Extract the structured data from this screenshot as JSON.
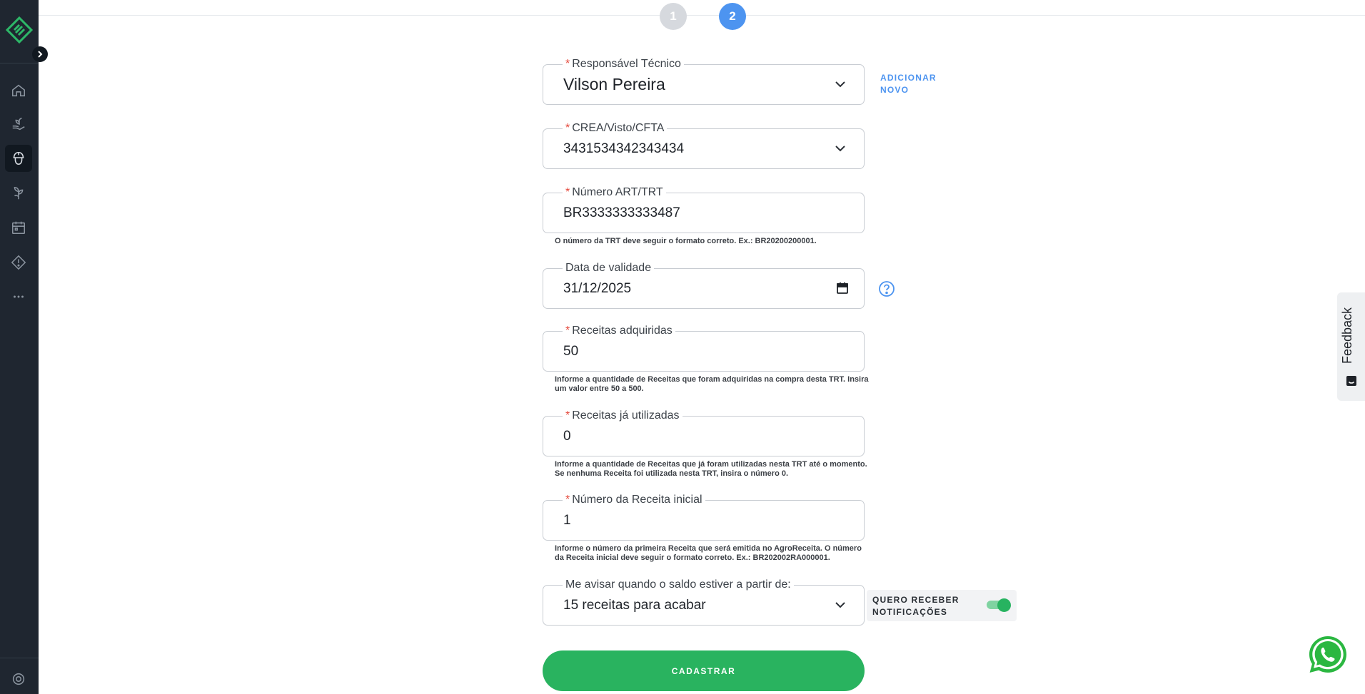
{
  "stepper": {
    "step1": "1",
    "step2": "2"
  },
  "form": {
    "responsavel": {
      "label": "Responsável Técnico",
      "value": "Vilson Pereira"
    },
    "add_new": {
      "line1": "ADICIONAR",
      "line2": "NOVO"
    },
    "crea": {
      "label": "CREA/Visto/CFTA",
      "value": "3431534342343434"
    },
    "art": {
      "label": "Número ART/TRT",
      "value": "BR3333333333487",
      "hint": "O número da TRT deve seguir o formato correto. Ex.: BR20200200001."
    },
    "validade": {
      "label": "Data de validade",
      "value": "31/12/2025"
    },
    "adquiridas": {
      "label": "Receitas adquiridas",
      "value": "50",
      "hint_line1": "Informe a quantidade de Receitas que foram adquiridas na compra desta TRT. Insira",
      "hint_line2": "um valor entre 50 a 500."
    },
    "utilizadas": {
      "label": "Receitas já utilizadas",
      "value": "0",
      "hint_line1": "Informe a quantidade de Receitas que já foram utilizadas nesta TRT até o momento.",
      "hint_line2": "Se nenhuma Receita foi utilizada nesta TRT, insira o número 0."
    },
    "inicial": {
      "label": "Número da Receita inicial",
      "value": "1",
      "hint_line1": "Informe o número da primeira Receita que será emitida no AgroReceita. O número",
      "hint_line2": "da Receita inicial deve seguir o formato correto. Ex.: BR202002RA000001."
    },
    "aviso": {
      "label": "Me avisar quando o saldo estiver a partir de:",
      "value": "15 receitas para acabar"
    },
    "notif": {
      "line1": "QUERO RECEBER",
      "line2": "NOTIFICAÇÕES",
      "enabled": true
    },
    "required_mark": "*",
    "submit": "CADASTRAR"
  },
  "feedback": {
    "label": "Feedback"
  },
  "icons": {
    "sidebar": [
      "home-icon",
      "hand-plant-icon",
      "engineer-helmet-icon",
      "seedling-icon",
      "calendar-icon",
      "warning-icon",
      "more-icon",
      "settings-icon"
    ]
  },
  "colors": {
    "sidebar_bg": "#1f2630",
    "accent_blue": "#4d94f0",
    "primary_green": "#29b35f",
    "brand_green": "#2db768"
  }
}
